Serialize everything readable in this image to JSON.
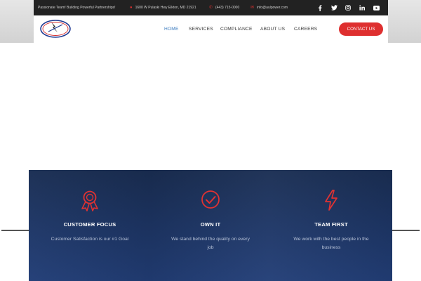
{
  "topbar": {
    "tagline": "Passionate Team! Building Powerful Partnerships!",
    "address": "1600 W Pulaski Hwy Elkton, MD 21921",
    "phone": "(443) 715-0000",
    "email": "info@aulpower.com",
    "socials": [
      "facebook-icon",
      "twitter-icon",
      "instagram-icon",
      "linkedin-icon",
      "youtube-icon"
    ]
  },
  "logo": {
    "text": "AUL POWER"
  },
  "nav": {
    "items": [
      {
        "label": "HOME",
        "active": true
      },
      {
        "label": "SERVICES",
        "active": false
      },
      {
        "label": "COMPLIANCE",
        "active": false
      },
      {
        "label": "ABOUT US",
        "active": false
      },
      {
        "label": "CAREERS",
        "active": false
      }
    ],
    "cta_label": "CONTACT US"
  },
  "features": [
    {
      "icon": "award-ribbon-icon",
      "title": "CUSTOMER FOCUS",
      "text": "Customer Satisfaction is our #1 Goal"
    },
    {
      "icon": "check-circle-icon",
      "title": "OWN IT",
      "text": "We stand behind the quality on every job"
    },
    {
      "icon": "lightning-bolt-icon",
      "title": "TEAM FIRST",
      "text": "We work with the best people in the business"
    }
  ],
  "colors": {
    "accent": "#de2f2f",
    "nav_active": "#3b7bbf",
    "topbar_bg": "#222222",
    "band_bg": "#1d3564"
  }
}
